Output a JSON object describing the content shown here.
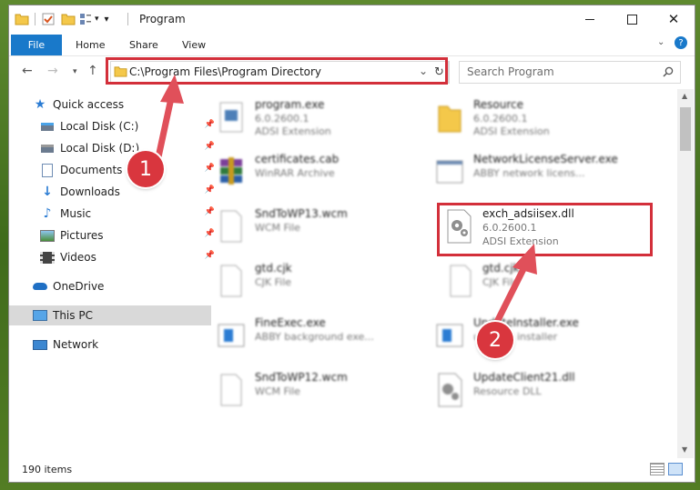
{
  "window": {
    "title": "Program"
  },
  "ribbon": {
    "file": "File",
    "tabs": [
      "Home",
      "Share",
      "View"
    ]
  },
  "address": {
    "path": "C:\\Program Files\\Program Directory"
  },
  "search": {
    "placeholder": "Search Program"
  },
  "sidebar": {
    "items": [
      {
        "label": "Quick access",
        "icon": "star-icon"
      },
      {
        "label": "Local Disk (C:)",
        "icon": "drive-icon",
        "pinned": true
      },
      {
        "label": "Local Disk (D:)",
        "icon": "drive-icon",
        "pinned": true
      },
      {
        "label": "Documents",
        "icon": "documents-icon",
        "pinned": true
      },
      {
        "label": "Downloads",
        "icon": "download-icon",
        "pinned": true
      },
      {
        "label": "Music",
        "icon": "music-icon",
        "pinned": true
      },
      {
        "label": "Pictures",
        "icon": "pictures-icon",
        "pinned": true
      },
      {
        "label": "Videos",
        "icon": "videos-icon",
        "pinned": true
      },
      {
        "label": "OneDrive",
        "icon": "cloud-icon"
      },
      {
        "label": "This PC",
        "icon": "computer-icon",
        "selected": true
      },
      {
        "label": "Network",
        "icon": "network-icon"
      }
    ]
  },
  "files": [
    {
      "name": "program.exe",
      "line2": "6.0.2600.1",
      "line3": "ADSI Extension"
    },
    {
      "name": "Resource",
      "line2": "6.0.2600.1",
      "line3": "ADSI Extension"
    },
    {
      "name": "certificates.cab",
      "line2": "WinRAR Archive",
      "line3": ""
    },
    {
      "name": "NetworkLicenseServer.exe",
      "line2": "ABBY network licens...",
      "line3": ""
    },
    {
      "name": "SndToWP13.wcm",
      "line2": "WCM File",
      "line3": ""
    },
    {
      "name": "exch_adsiisex.dll",
      "line2": "6.0.2600.1",
      "line3": "ADSI Extension"
    },
    {
      "name": "gtd.cjk",
      "line2": "CJK File",
      "line3": ""
    },
    {
      "name": "gtd.cjk",
      "line2": "CJK File",
      "line3": ""
    },
    {
      "name": "FineExec.exe",
      "line2": "ABBY background exe...",
      "line3": ""
    },
    {
      "name": "UpdateInstaller.exe",
      "line2": "updates installer",
      "line3": ""
    },
    {
      "name": "SndToWP12.wcm",
      "line2": "WCM File",
      "line3": ""
    },
    {
      "name": "UpdateClient21.dll",
      "line2": "Resource DLL",
      "line3": ""
    }
  ],
  "status": {
    "count": "190 items"
  },
  "annotations": {
    "step1": "1",
    "step2": "2"
  },
  "colors": {
    "accent": "#1979ca",
    "highlight": "#d32f3a"
  }
}
